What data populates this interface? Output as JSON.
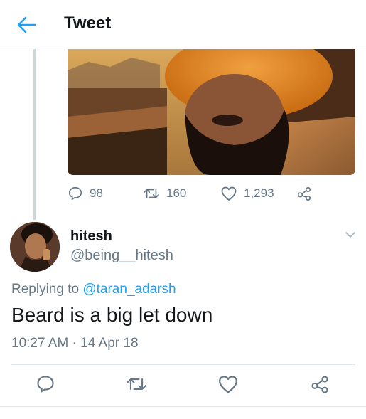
{
  "header": {
    "title": "Tweet"
  },
  "parent_tweet": {
    "reply_count": "98",
    "retweet_count": "160",
    "like_count": "1,293"
  },
  "reply": {
    "display_name": "hitesh",
    "handle": "@being__hitesh",
    "replying_prefix": "Replying to ",
    "replying_to": "@taran_adarsh",
    "text": "Beard is a big let down",
    "timestamp": "10:27 AM · 14 Apr 18"
  },
  "colors": {
    "accent": "#1da1f2",
    "muted": "#657786",
    "text": "#14171a",
    "divider": "#e1e8ed"
  },
  "icons": [
    "back-arrow-icon",
    "reply-icon",
    "retweet-icon",
    "like-icon",
    "share-icon",
    "chevron-down-icon"
  ]
}
